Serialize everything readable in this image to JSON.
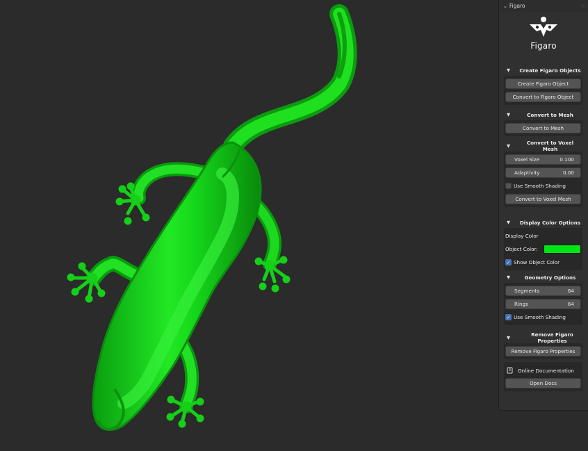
{
  "panel": {
    "title": "Figaro",
    "logo_text": "Figaro"
  },
  "sections": {
    "create": {
      "title": "Create Figaro Objects",
      "create_button": "Create Figaro Object",
      "convert_button": "Convert to Figaro Object"
    },
    "mesh": {
      "title": "Convert to Mesh",
      "convert_button": "Convert to Mesh"
    },
    "voxel": {
      "title": "Convert to Voxel Mesh",
      "voxel_size_label": "Voxel Size",
      "voxel_size_value": "0.100",
      "adaptivity_label": "Adaptivity",
      "adaptivity_value": "0.00",
      "smooth_label": "Use Smooth Shading",
      "smooth_checked": false,
      "convert_button": "Convert to Voxel Mesh"
    },
    "display": {
      "title": "Display Color Options",
      "display_color_label": "Display Color",
      "object_color_label": "Object Color:",
      "object_color": "#00e614",
      "show_color_label": "Show Object Color",
      "show_color_checked": true
    },
    "geometry": {
      "title": "Geometry Options",
      "segments_label": "Segments",
      "segments_value": "64",
      "rings_label": "Rings",
      "rings_value": "64",
      "smooth_label": "Use Smooth Shading",
      "smooth_checked": true
    },
    "remove": {
      "title": "Remove Figaro Properties",
      "remove_button": "Remove Figaro Properties",
      "docs_label": "Online Documentation",
      "docs_button": "Open Docs"
    }
  },
  "colors": {
    "viewport_bg": "#2b2b2b",
    "model_green": "#00e614",
    "checkbox_blue": "#4772b3"
  },
  "icons": {
    "collapse": "chevron-down-icon",
    "section_toggle": "triangle-down-icon",
    "docs": "book-icon",
    "logo": "figaro-logo-icon"
  }
}
